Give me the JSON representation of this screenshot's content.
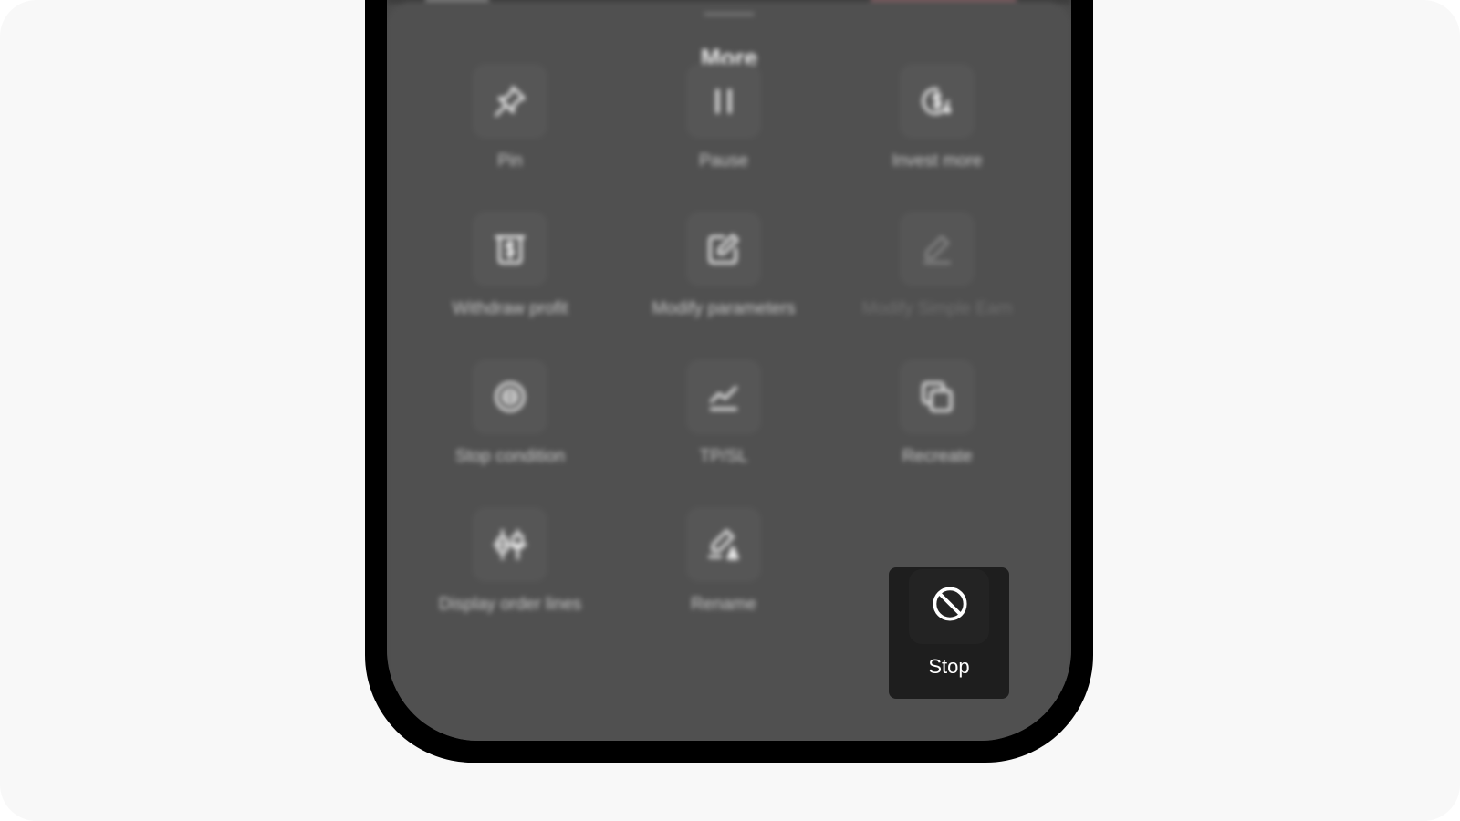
{
  "sheet": {
    "title": "More"
  },
  "actions": [
    {
      "label": "Pin",
      "icon": "pin-icon",
      "disabled": false
    },
    {
      "label": "Pause",
      "icon": "pause-icon",
      "disabled": false
    },
    {
      "label": "Invest more",
      "icon": "invest-more-icon",
      "disabled": false
    },
    {
      "label": "Withdraw profit",
      "icon": "withdraw-profit-icon",
      "disabled": false
    },
    {
      "label": "Modify parameters",
      "icon": "edit-icon",
      "disabled": false
    },
    {
      "label": "Modify Simple Earn",
      "icon": "pencil-icon",
      "disabled": true
    },
    {
      "label": "Stop condition",
      "icon": "stop-condition-icon",
      "disabled": false
    },
    {
      "label": "TP/SL",
      "icon": "chart-line-icon",
      "disabled": false
    },
    {
      "label": "Recreate",
      "icon": "copy-icon",
      "disabled": false
    },
    {
      "label": "Display order lines",
      "icon": "candlestick-icon",
      "disabled": false
    },
    {
      "label": "Rename",
      "icon": "rename-icon",
      "disabled": false
    },
    {
      "label": "Stop",
      "icon": "prohibited-icon",
      "disabled": false,
      "highlighted": true
    }
  ],
  "colors": {
    "page_background": "#f8f8f8",
    "phone_frame": "#000000",
    "sheet_background": "#505050",
    "highlight_background": "#1e1e1e",
    "highlight_text": "#ffffff"
  }
}
